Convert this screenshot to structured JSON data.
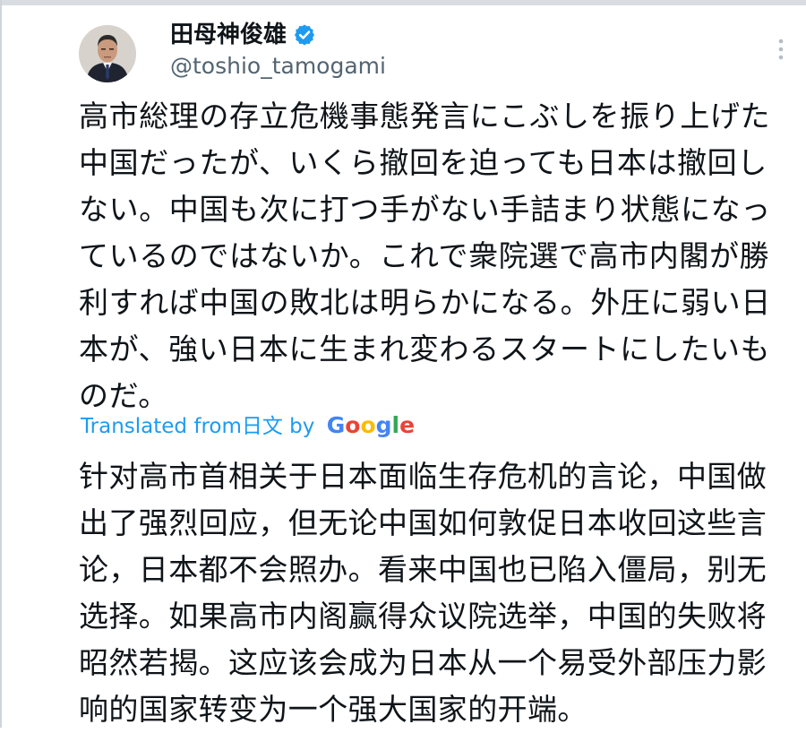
{
  "tweet": {
    "author": {
      "display_name": "田母神俊雄",
      "handle": "@toshio_tamogami",
      "verified": true,
      "avatar_icon": "avatar-portrait"
    },
    "menu_icon": "more-vertical-icon",
    "original_text": "高市総理の存立危機事態発言にこぶしを振り上げた中国だったが、いくら撤回を迫っても日本は撤回しない。中国も次に打つ手がない手詰まり状態になっているのではないか。これで衆院選で高市内閣が勝利すれば中国の敗北は明らかになる。外圧に弱い日本が、強い日本に生まれ変わるスタートにしたいものだ。",
    "translation": {
      "prefix": "Translated from ",
      "language": "日文",
      "by": " by ",
      "provider_letters": [
        "G",
        "o",
        "o",
        "g",
        "l",
        "e"
      ],
      "text": "针对高市首相关于日本面临生存危机的言论，中国做出了强烈回应，但无论中国如何敦促日本收回这些言论，日本都不会照办。看来中国也已陷入僵局，别无选择。如果高市内阁赢得众议院选举，中国的失败将昭然若揭。这应该会成为日本从一个易受外部压力影响的国家转变为一个强大国家的开端。"
    }
  },
  "colors": {
    "link": "#1d9bf0",
    "verified": "#1d9bf0",
    "secondary_text": "#536471",
    "primary_text": "#0f1419"
  }
}
